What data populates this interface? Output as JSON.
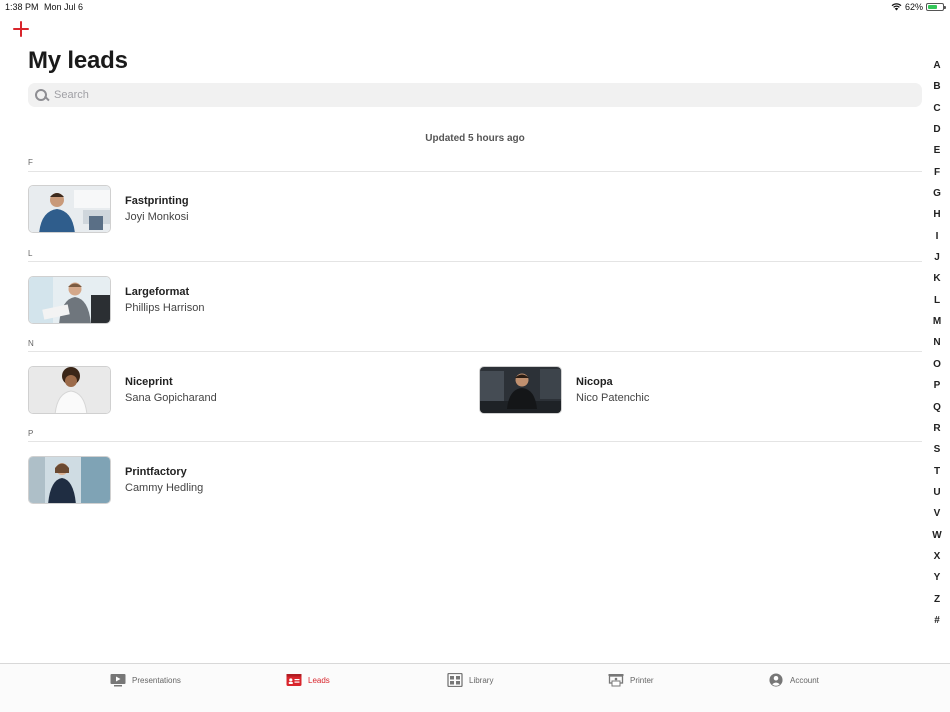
{
  "status_bar": {
    "time": "1:38 PM",
    "date": "Mon Jul 6",
    "battery": "62%"
  },
  "header": {
    "title": "My leads"
  },
  "search": {
    "placeholder": "Search"
  },
  "updated_text": "Updated 5 hours ago",
  "sections": [
    {
      "letter": "F",
      "leads": [
        {
          "company": "Fastprinting",
          "person": "Joyi Monkosi"
        }
      ]
    },
    {
      "letter": "L",
      "leads": [
        {
          "company": "Largeformat",
          "person": "Phillips Harrison"
        }
      ]
    },
    {
      "letter": "N",
      "leads": [
        {
          "company": "Niceprint",
          "person": "Sana Gopicharand"
        },
        {
          "company": "Nicopa",
          "person": "Nico Patenchic"
        }
      ]
    },
    {
      "letter": "P",
      "leads": [
        {
          "company": "Printfactory",
          "person": "Cammy Hedling"
        }
      ]
    }
  ],
  "alphabet": [
    "A",
    "B",
    "C",
    "D",
    "E",
    "F",
    "G",
    "H",
    "I",
    "J",
    "K",
    "L",
    "M",
    "N",
    "O",
    "P",
    "Q",
    "R",
    "S",
    "T",
    "U",
    "V",
    "W",
    "X",
    "Y",
    "Z",
    "#"
  ],
  "tabs": [
    {
      "label": "Presentations",
      "icon": "presentation-icon"
    },
    {
      "label": "Leads",
      "icon": "leads-icon",
      "active": true
    },
    {
      "label": "Library",
      "icon": "library-icon"
    },
    {
      "label": "Printer",
      "icon": "printer-icon"
    },
    {
      "label": "Account",
      "icon": "account-icon"
    }
  ],
  "colors": {
    "accent": "#d9252c",
    "battery": "#34c759"
  }
}
